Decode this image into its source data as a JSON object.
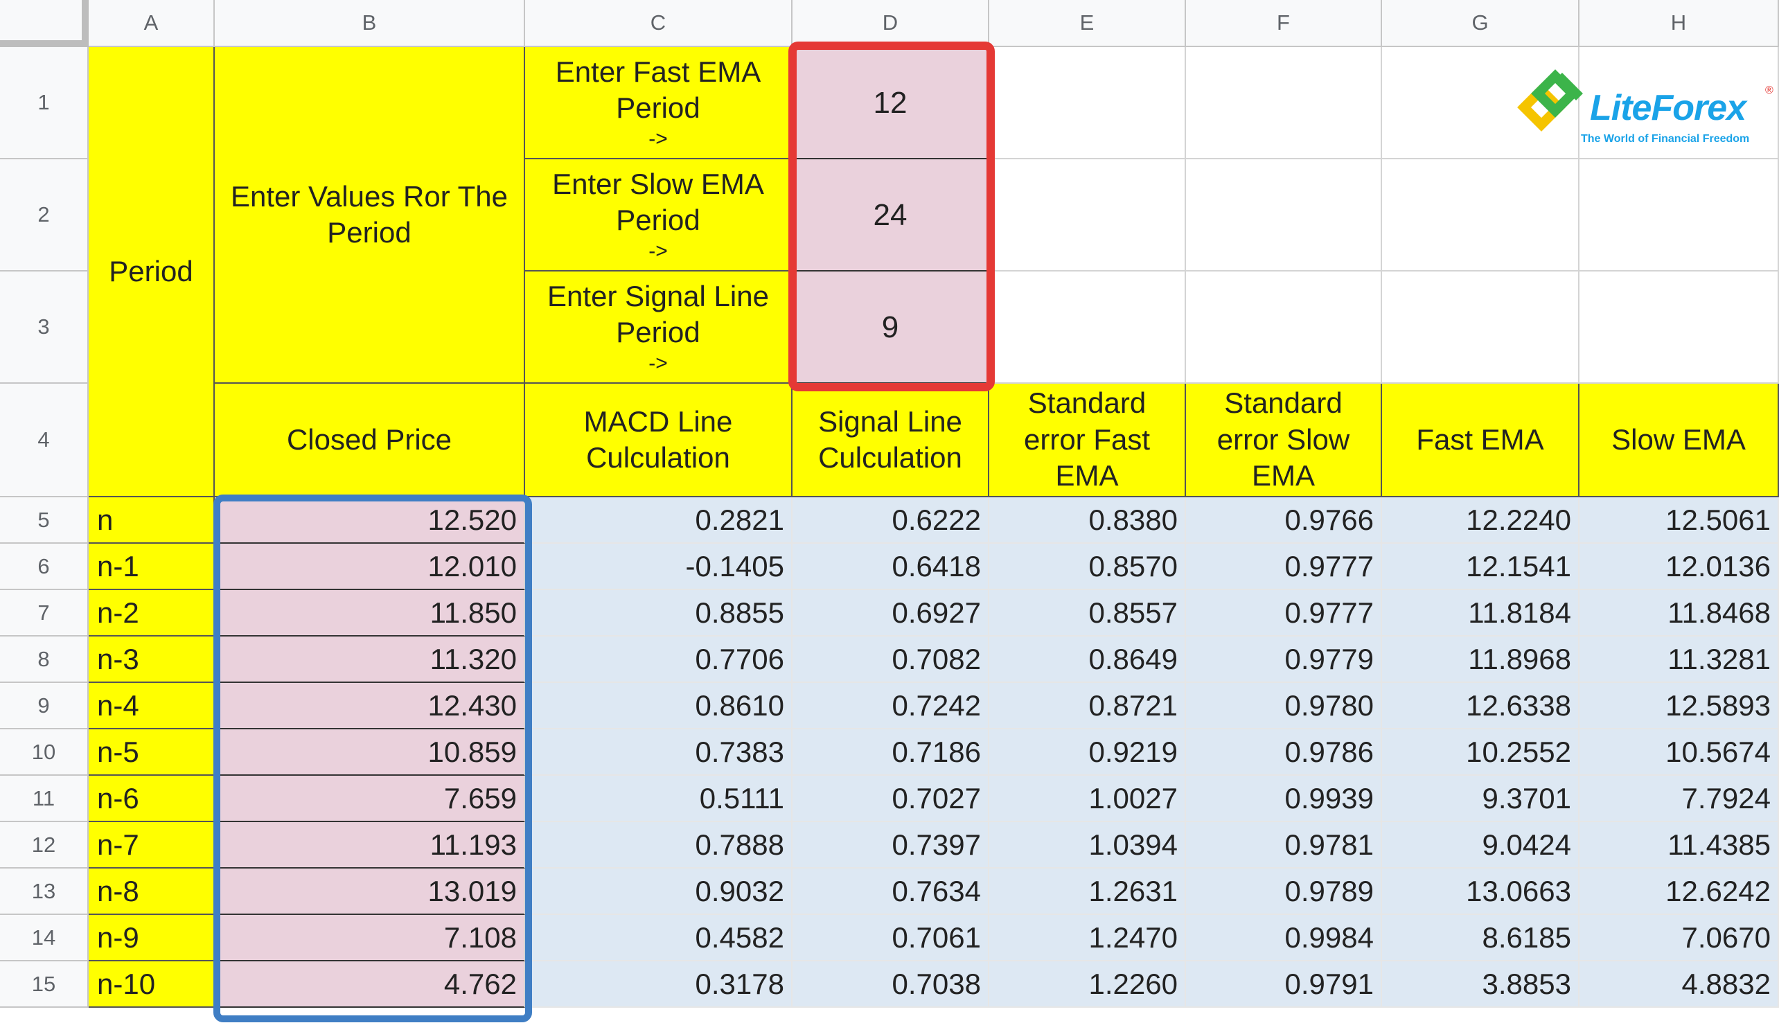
{
  "columns": [
    "A",
    "B",
    "C",
    "D",
    "E",
    "F",
    "G",
    "H"
  ],
  "rows": [
    "1",
    "2",
    "3",
    "4",
    "5",
    "6",
    "7",
    "8",
    "9",
    "10",
    "11",
    "12",
    "13",
    "14",
    "15"
  ],
  "settings": {
    "period_header": "Period",
    "enter_values": "Enter Values Ror The Period",
    "labels": [
      {
        "line1": "Enter Fast EMA",
        "line2": "Period",
        "arrow": "->"
      },
      {
        "line1": "Enter Slow EMA",
        "line2": "Period",
        "arrow": "->"
      },
      {
        "line1": "Enter Signal Line",
        "line2": "Period",
        "arrow": "->"
      }
    ],
    "values": [
      "12",
      "24",
      "9"
    ]
  },
  "table_headers": {
    "closed_price": "Closed Price",
    "macd_line": "MACD Line Culculation",
    "signal_line": "Signal Line Culculation",
    "se_fast": "Standard error Fast EMA",
    "se_slow": "Standard error Slow EMA",
    "fast_ema": "Fast EMA",
    "slow_ema": "Slow EMA"
  },
  "data_rows": [
    {
      "period": "n",
      "closed": "12.520",
      "macd": "0.2821",
      "signal": "0.6222",
      "se_fast": "0.8380",
      "se_slow": "0.9766",
      "fast": "12.2240",
      "slow": "12.5061"
    },
    {
      "period": "n-1",
      "closed": "12.010",
      "macd": "-0.1405",
      "signal": "0.6418",
      "se_fast": "0.8570",
      "se_slow": "0.9777",
      "fast": "12.1541",
      "slow": "12.0136"
    },
    {
      "period": "n-2",
      "closed": "11.850",
      "macd": "0.8855",
      "signal": "0.6927",
      "se_fast": "0.8557",
      "se_slow": "0.9777",
      "fast": "11.8184",
      "slow": "11.8468"
    },
    {
      "period": "n-3",
      "closed": "11.320",
      "macd": "0.7706",
      "signal": "0.7082",
      "se_fast": "0.8649",
      "se_slow": "0.9779",
      "fast": "11.8968",
      "slow": "11.3281"
    },
    {
      "period": "n-4",
      "closed": "12.430",
      "macd": "0.8610",
      "signal": "0.7242",
      "se_fast": "0.8721",
      "se_slow": "0.9780",
      "fast": "12.6338",
      "slow": "12.5893"
    },
    {
      "period": "n-5",
      "closed": "10.859",
      "macd": "0.7383",
      "signal": "0.7186",
      "se_fast": "0.9219",
      "se_slow": "0.9786",
      "fast": "10.2552",
      "slow": "10.5674"
    },
    {
      "period": "n-6",
      "closed": "7.659",
      "macd": "0.5111",
      "signal": "0.7027",
      "se_fast": "1.0027",
      "se_slow": "0.9939",
      "fast": "9.3701",
      "slow": "7.7924"
    },
    {
      "period": "n-7",
      "closed": "11.193",
      "macd": "0.7888",
      "signal": "0.7397",
      "se_fast": "1.0394",
      "se_slow": "0.9781",
      "fast": "9.0424",
      "slow": "11.4385"
    },
    {
      "period": "n-8",
      "closed": "13.019",
      "macd": "0.9032",
      "signal": "0.7634",
      "se_fast": "1.2631",
      "se_slow": "0.9789",
      "fast": "13.0663",
      "slow": "12.6242"
    },
    {
      "period": "n-9",
      "closed": "7.108",
      "macd": "0.4582",
      "signal": "0.7061",
      "se_fast": "1.2470",
      "se_slow": "0.9984",
      "fast": "8.6185",
      "slow": "7.0670"
    },
    {
      "period": "n-10",
      "closed": "4.762",
      "macd": "0.3178",
      "signal": "0.7038",
      "se_fast": "1.2260",
      "se_slow": "0.9791",
      "fast": "3.8853",
      "slow": "4.8832"
    }
  ],
  "logo": {
    "name": "LiteForex",
    "tagline": "The World of Financial Freedom",
    "registered": "®"
  },
  "colors": {
    "yellow": "#ffff00",
    "pink": "#ead1dc",
    "blue": "#dde8f3",
    "red_outline": "#e53935",
    "blue_outline": "#3f7ec4",
    "brand": "#1aa3e8",
    "logo_green": "#3cb44a",
    "logo_yellow": "#f5c400"
  }
}
